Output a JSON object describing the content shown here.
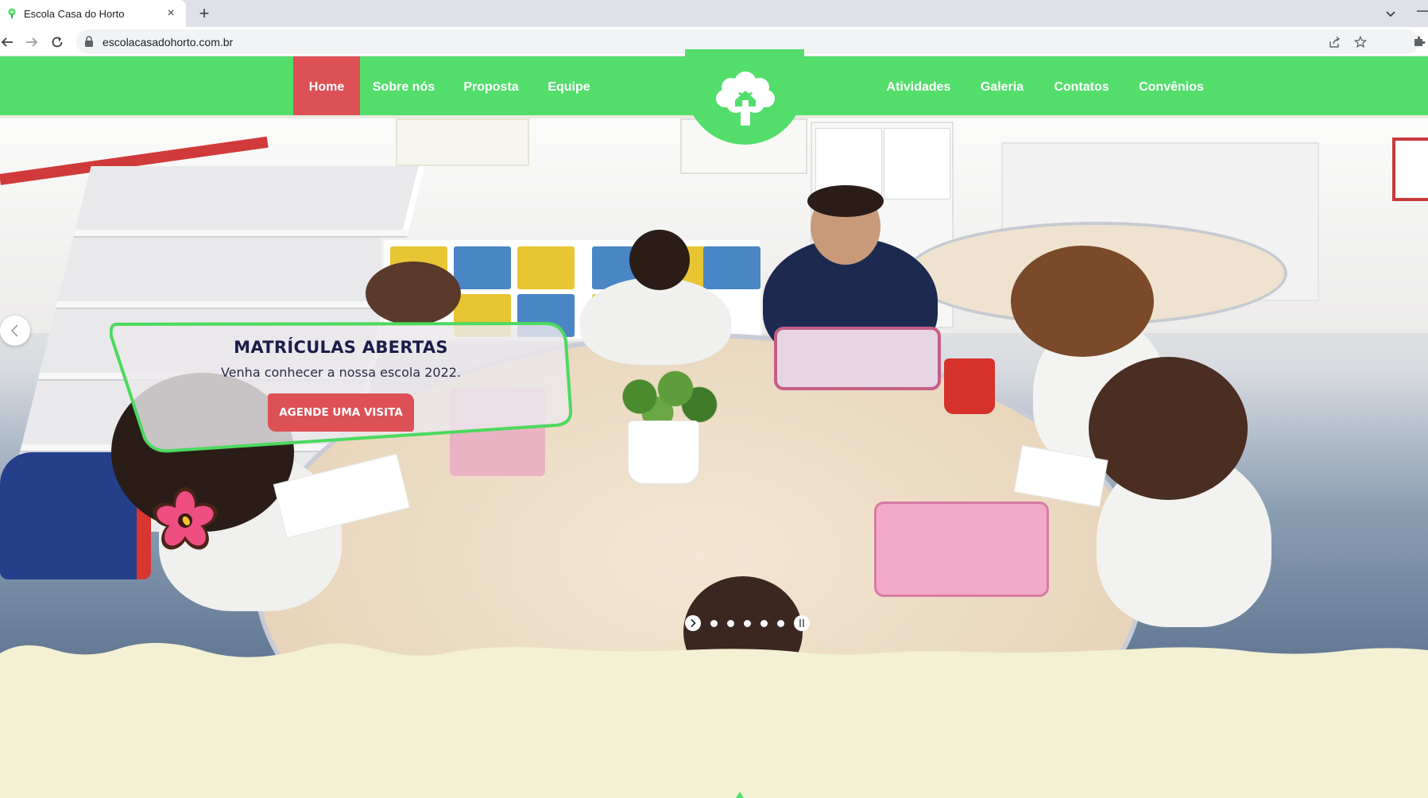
{
  "browser": {
    "tab_title": "Escola Casa do Horto",
    "tab_close": "×",
    "new_tab": "+",
    "url": "escolacasadohorto.com.br"
  },
  "nav": {
    "left_items": [
      {
        "label": "Home",
        "active": true
      },
      {
        "label": "Sobre nós",
        "active": false
      },
      {
        "label": "Proposta",
        "active": false
      },
      {
        "label": "Equipe",
        "active": false
      }
    ],
    "right_items": [
      {
        "label": "Atividades"
      },
      {
        "label": "Galeria"
      },
      {
        "label": "Contatos"
      },
      {
        "label": "Convênios"
      }
    ],
    "logo_icon": "tree-house-icon"
  },
  "hero": {
    "promo_title": "MATRÍCULAS ABERTAS",
    "promo_subtitle": "Venha conhecer a nossa escola 2022.",
    "promo_button": "AGENDE UMA VISITA",
    "slide_count": 5
  },
  "colors": {
    "nav_green": "#53de6c",
    "active_red": "#dd5055",
    "cream": "#f3f0d3",
    "promo_border": "#4cd95f",
    "title_navy": "#1c1c4a"
  }
}
